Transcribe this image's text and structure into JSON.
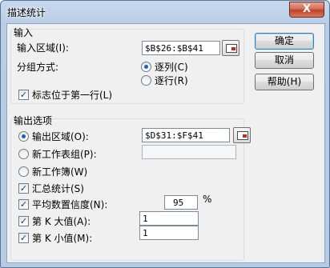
{
  "window": {
    "title": "描述统计",
    "close_glyph": "X"
  },
  "input_section": {
    "header": "输入",
    "range_label": "输入区域(I):",
    "range_value": "$B$26:$B$41",
    "group_by_label": "分组方式:",
    "group_options": [
      {
        "label": "逐列(C)",
        "selected": true
      },
      {
        "label": "逐行(R)",
        "selected": false
      }
    ],
    "labels_first_row": {
      "label": "标志位于第一行(L)",
      "checked": true
    }
  },
  "output_section": {
    "header": "输出选项",
    "output_range": {
      "label": "输出区域(O):",
      "value": "$D$31:$F$41",
      "selected": true
    },
    "new_worksheet": {
      "label": "新工作表组(P):",
      "value": "",
      "selected": false
    },
    "new_workbook": {
      "label": "新工作簿(W)",
      "selected": false
    },
    "summary_stats": {
      "label": "汇总统计(S)",
      "checked": true
    },
    "confidence": {
      "label": "平均数置信度(N):",
      "value": "95",
      "unit": "%",
      "checked": true
    },
    "kth_largest": {
      "label": "第 K 大值(A):",
      "value": "1",
      "checked": true
    },
    "kth_smallest": {
      "label": "第 K 小值(M):",
      "value": "1",
      "checked": true
    }
  },
  "buttons": {
    "ok": "确定",
    "cancel": "取消",
    "help": "帮助(H)"
  },
  "check_glyph": "✓"
}
